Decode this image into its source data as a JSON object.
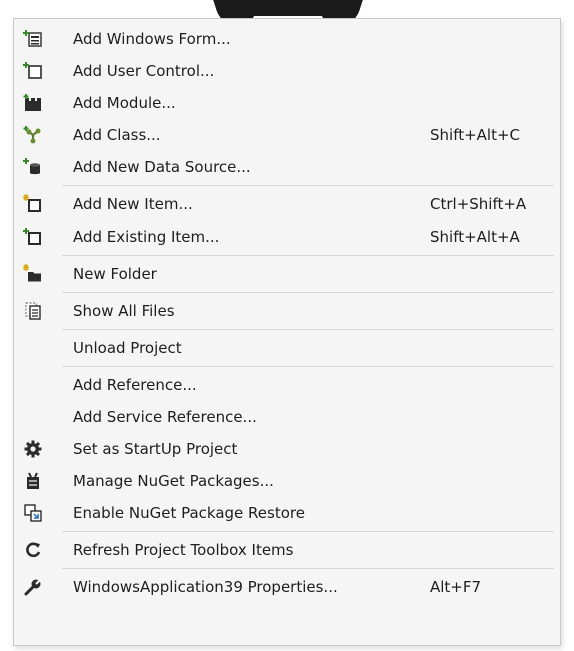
{
  "menu": {
    "items": [
      {
        "label": "Add Windows Form...",
        "shortcut": "",
        "icon": "windows-form-icon"
      },
      {
        "label": "Add User Control...",
        "shortcut": "",
        "icon": "user-control-icon"
      },
      {
        "label": "Add Module...",
        "shortcut": "",
        "icon": "module-icon"
      },
      {
        "label": "Add Class...",
        "shortcut": "Shift+Alt+C",
        "icon": "class-icon"
      },
      {
        "label": "Add New Data Source...",
        "shortcut": "",
        "icon": "data-source-icon"
      },
      {
        "label": "Add New Item...",
        "shortcut": "Ctrl+Shift+A",
        "icon": "new-item-icon"
      },
      {
        "label": "Add Existing Item...",
        "shortcut": "Shift+Alt+A",
        "icon": "existing-item-icon"
      },
      {
        "label": "New Folder",
        "shortcut": "",
        "icon": "new-folder-icon"
      },
      {
        "label": "Show All Files",
        "shortcut": "",
        "icon": "show-all-files-icon"
      },
      {
        "label": "Unload Project",
        "shortcut": "",
        "icon": ""
      },
      {
        "label": "Add Reference...",
        "shortcut": "",
        "icon": ""
      },
      {
        "label": "Add Service Reference...",
        "shortcut": "",
        "icon": ""
      },
      {
        "label": "Set as StartUp Project",
        "shortcut": "",
        "icon": "gear-icon"
      },
      {
        "label": "Manage NuGet Packages...",
        "shortcut": "",
        "icon": "nuget-icon"
      },
      {
        "label": "Enable NuGet Package Restore",
        "shortcut": "",
        "icon": "package-restore-icon"
      },
      {
        "label": "Refresh Project Toolbox Items",
        "shortcut": "",
        "icon": "refresh-icon"
      },
      {
        "label": "WindowsApplication39 Properties...",
        "shortcut": "Alt+F7",
        "icon": "wrench-icon"
      }
    ]
  }
}
